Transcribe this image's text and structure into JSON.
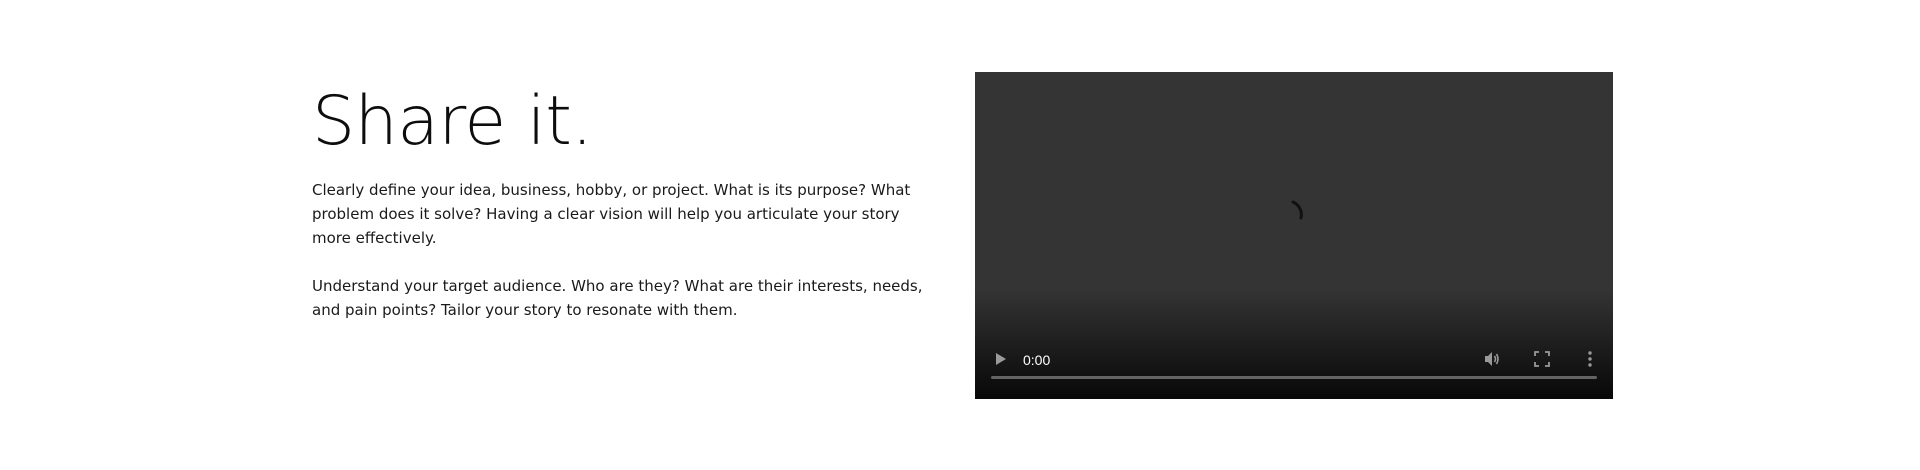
{
  "section": {
    "title": "Share it.",
    "paragraphs": [
      "Clearly define your idea, business, hobby, or project. What is its purpose? What problem does it solve? Having a clear vision will help you articulate your story more effectively.",
      "Understand your target audience. Who are they? What are their interests, needs, and pain points? Tailor your story to resonate with them."
    ]
  },
  "video": {
    "current_time": "0:00",
    "icons": {
      "play": "play-icon",
      "mute": "volume-icon",
      "fullscreen": "fullscreen-icon",
      "menu": "more-options-icon",
      "loading": "loading-spinner-icon"
    },
    "progress": 0
  }
}
